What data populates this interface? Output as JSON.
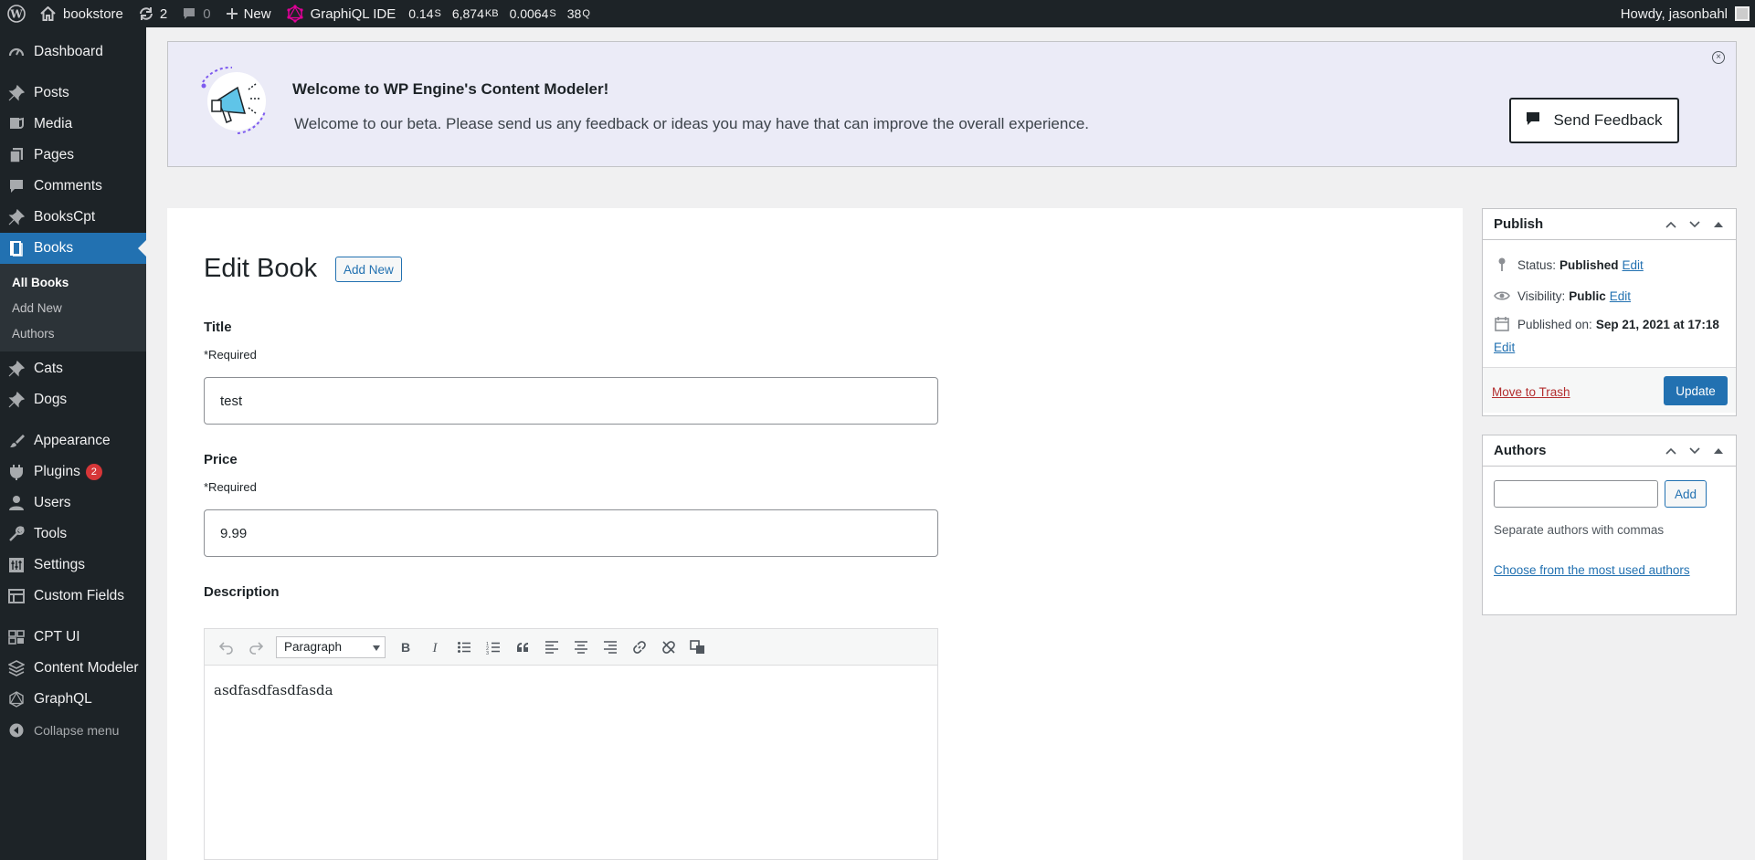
{
  "admin_bar": {
    "site_name": "bookstore",
    "updates_count": "2",
    "comments_count": "0",
    "new_label": "New",
    "graphiql_label": "GraphiQL IDE",
    "stat_time": "0.14",
    "stat_time_unit": "S",
    "stat_memory": "6,874",
    "stat_memory_unit": "KB",
    "stat_query_time": "0.0064",
    "stat_query_time_unit": "S",
    "stat_queries": "38",
    "stat_queries_unit": "Q",
    "greeting": "Howdy, jasonbahl"
  },
  "sidebar": {
    "dashboard": "Dashboard",
    "posts": "Posts",
    "media": "Media",
    "pages": "Pages",
    "comments": "Comments",
    "bookscpt": "BooksCpt",
    "books": "Books",
    "books_sub": [
      "All Books",
      "Add New",
      "Authors"
    ],
    "cats": "Cats",
    "dogs": "Dogs",
    "appearance": "Appearance",
    "plugins": "Plugins",
    "plugins_badge": "2",
    "users": "Users",
    "tools": "Tools",
    "settings": "Settings",
    "custom_fields": "Custom Fields",
    "cpt_ui": "CPT UI",
    "content_modeler": "Content Modeler",
    "graphql": "GraphQL",
    "collapse": "Collapse menu"
  },
  "notice": {
    "title": "Welcome to WP Engine's Content Modeler!",
    "message": "Welcome to our beta. Please send us any feedback or ideas you may have that can improve the overall experience.",
    "feedback_button": "Send Feedback"
  },
  "editor": {
    "heading": "Edit Book",
    "add_new": "Add New",
    "title_label": "Title",
    "title_required": "*Required",
    "title_value": "test",
    "price_label": "Price",
    "price_required": "*Required",
    "price_value": "9.99",
    "description_label": "Description",
    "format_select": "Paragraph",
    "description_content": "asdfasdfasdfasda"
  },
  "publish": {
    "title": "Publish",
    "status_label": "Status:",
    "status_value": "Published",
    "visibility_label": "Visibility:",
    "visibility_value": "Public",
    "published_label": "Published on:",
    "published_value": "Sep 21, 2021 at 17:18",
    "edit": "Edit",
    "trash": "Move to Trash",
    "update": "Update"
  },
  "authors_box": {
    "title": "Authors",
    "input_value": "",
    "add": "Add",
    "hint": "Separate authors with commas",
    "choose": "Choose from the most used authors"
  },
  "colors": {
    "admin_dark": "#1d2327",
    "accent": "#2271b1",
    "notice_bg": "#ebebf7",
    "danger": "#b32d2e"
  }
}
